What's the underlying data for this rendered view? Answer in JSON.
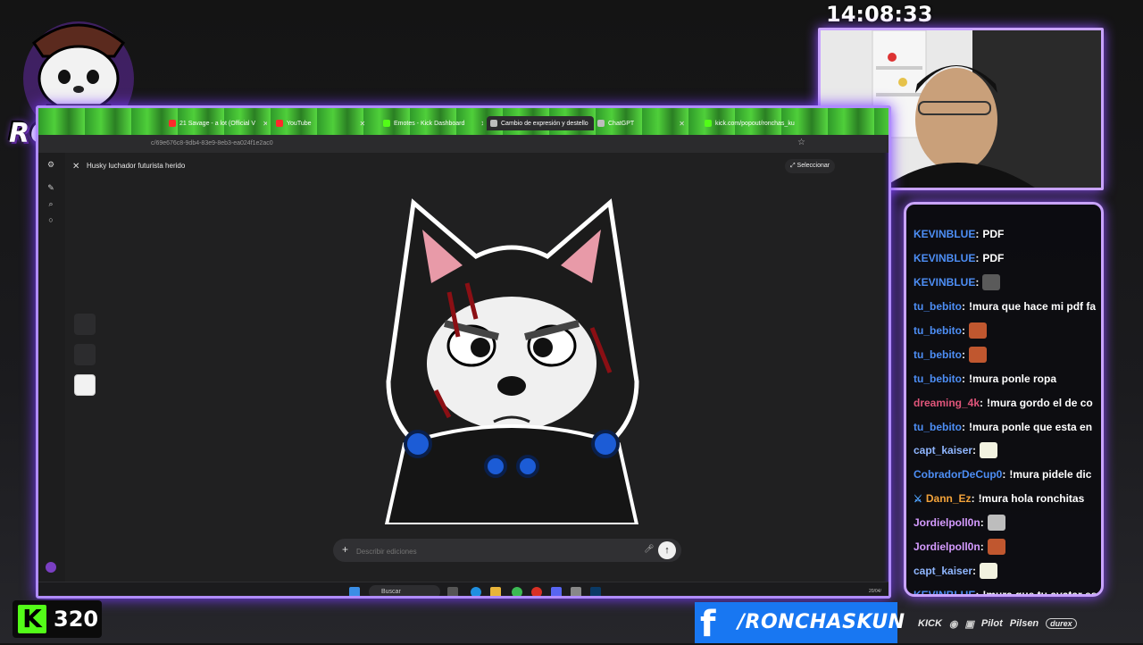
{
  "overlay": {
    "logo_text": "RONCHAS",
    "clock": "14:08:33",
    "kick_viewers": "320",
    "facebook_handle": "/RONCHASKUN",
    "sponsors": [
      "KICK",
      "Pilot",
      "Pilsen",
      "durex"
    ]
  },
  "browser": {
    "tabs": [
      {
        "label": "21 Savage - a lot (Official V",
        "favicon": "youtube-icon"
      },
      {
        "label": "YouTube",
        "favicon": "youtube-icon"
      },
      {
        "label": "Emotes - Kick Dashboard",
        "favicon": "kick-icon"
      },
      {
        "label": "Cambio de expresión y destello",
        "favicon": "chatgpt-icon",
        "active": true
      },
      {
        "label": "ChatGPT",
        "favicon": "chatgpt-icon"
      },
      {
        "label": "kick.com/popout/ronchas_ku",
        "favicon": "kick-icon"
      }
    ],
    "url": "c/69e676c8-9db4-83e9-8eb3-ea024f1e2ac0",
    "document_title": "Husky luchador futurista herido",
    "select_label": "Seleccionar",
    "prompt_placeholder": "Describir ediciones",
    "taskbar_search": "Buscar",
    "taskbar_date": "20/04/"
  },
  "chat": {
    "messages": [
      {
        "user": "KEVINBLUE",
        "text": "PDF",
        "color": "#4d8ef5"
      },
      {
        "user": "KEVINBLUE",
        "text": "PDF",
        "color": "#4d8ef5"
      },
      {
        "user": "KEVINBLUE",
        "text": "",
        "emote": "shoe-emote",
        "color": "#4d8ef5"
      },
      {
        "user": "tu_bebito",
        "text": "!mura que hace mi pdf fa",
        "color": "#4d8ef5"
      },
      {
        "user": "tu_bebito",
        "text": "",
        "emote": "face-emote",
        "color": "#4d8ef5"
      },
      {
        "user": "tu_bebito",
        "text": "",
        "emote": "face-emote",
        "color": "#4d8ef5"
      },
      {
        "user": "tu_bebito",
        "text": "!mura ponle ropa",
        "color": "#4d8ef5"
      },
      {
        "user": "dreaming_4k",
        "text": "!mura gordo el de co",
        "color": "#e0557a"
      },
      {
        "user": "tu_bebito",
        "text": "!mura ponle que esta en",
        "color": "#4d8ef5"
      },
      {
        "user": "capt_kaiser",
        "text": "",
        "emote": "duck-emote",
        "color": "#8fb6ff"
      },
      {
        "user": "CobradorDeCup0",
        "text": "!mura pidele dic",
        "color": "#4d8ef5"
      },
      {
        "user": "Dann_Ez",
        "text": "!mura hola ronchitas",
        "color": "#f2a23a",
        "badge": "sword-icon"
      },
      {
        "user": "Jordielpoll0n",
        "text": "",
        "emote": "cat-emote",
        "color": "#d59bff"
      },
      {
        "user": "Jordielpoll0n",
        "text": "",
        "emote": "face-emote",
        "color": "#d59bff"
      },
      {
        "user": "capt_kaiser",
        "text": "",
        "emote": "duck-emote",
        "color": "#8fb6ff"
      },
      {
        "user": "KEVINBLUE",
        "text": "!mura que tu avatar es",
        "color": "#4d8ef5"
      }
    ]
  }
}
